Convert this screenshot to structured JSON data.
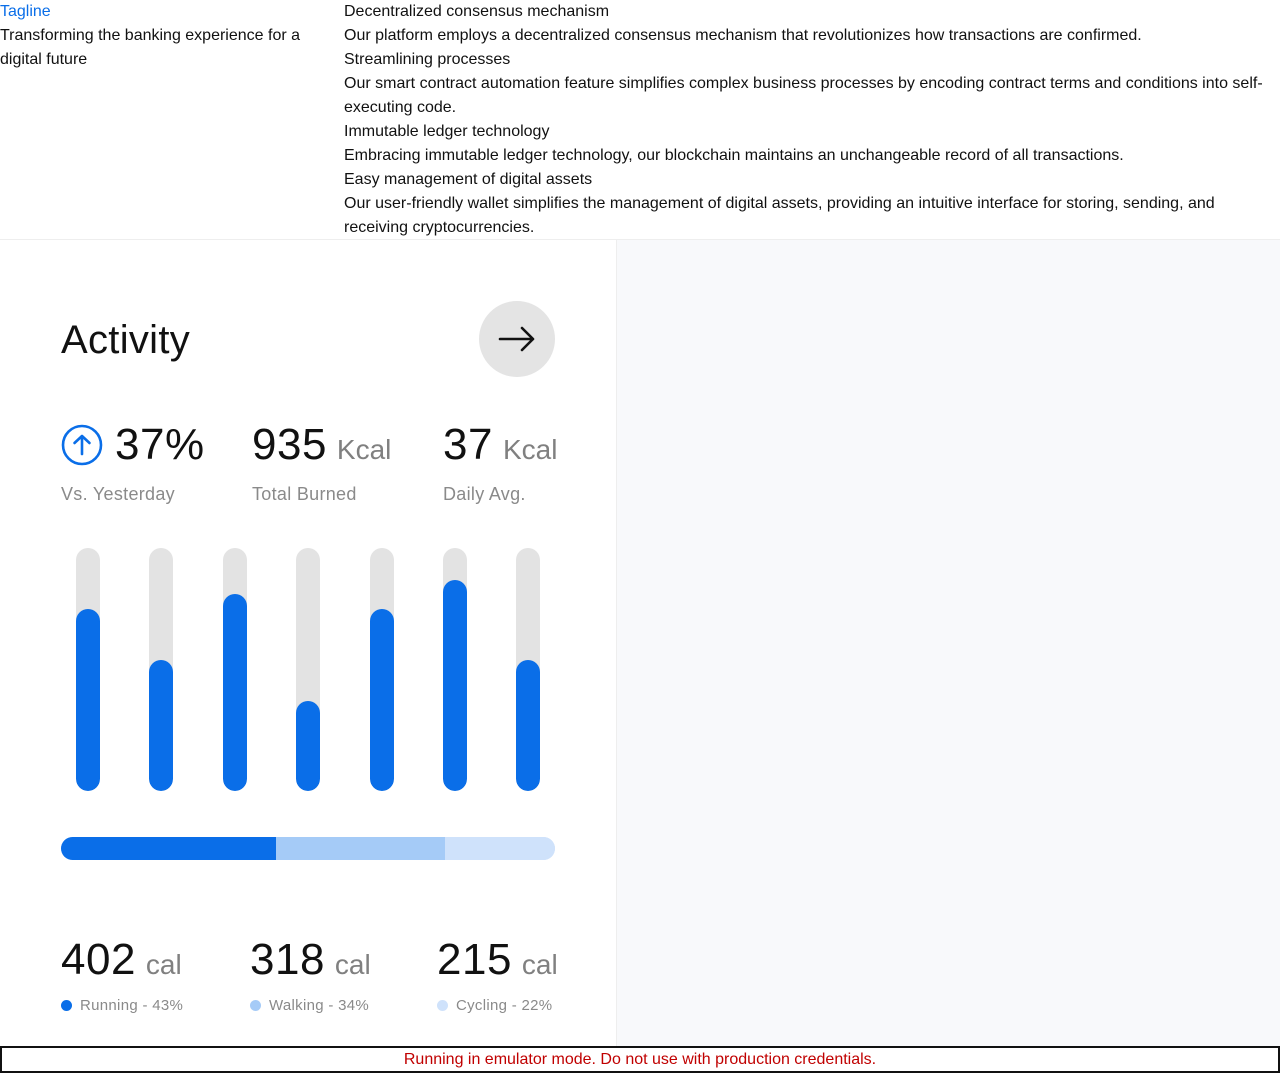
{
  "top": {
    "tagline_label": "Tagline",
    "tagline_text": "Transforming the banking experience for a digital future",
    "features": [
      {
        "title": "Decentralized consensus mechanism",
        "desc": "Our platform employs a decentralized consensus mechanism that revolutionizes how transactions are confirmed."
      },
      {
        "title": "Streamlining processes",
        "desc": "Our smart contract automation feature simplifies complex business processes by encoding contract terms and conditions into self-executing code."
      },
      {
        "title": "Immutable ledger technology",
        "desc": "Embracing immutable ledger technology, our blockchain maintains an unchangeable record of all transactions."
      },
      {
        "title": "Easy management of digital assets",
        "desc": "Our user-friendly wallet simplifies the management of digital assets, providing an intuitive interface for storing, sending, and receiving cryptocurrencies."
      }
    ]
  },
  "card": {
    "title": "Activity",
    "arrow_icon": "arrow-right-icon",
    "stats": [
      {
        "value": "37%",
        "unit": "",
        "label": "Vs. Yesterday",
        "icon": "arrow-up-circle-icon"
      },
      {
        "value": "935",
        "unit": "Kcal",
        "label": "Total Burned"
      },
      {
        "value": "37",
        "unit": "Kcal",
        "label": "Daily Avg."
      }
    ],
    "chart_data": {
      "type": "bar",
      "values": [
        0.75,
        0.54,
        0.81,
        0.37,
        0.75,
        0.87,
        0.54
      ]
    },
    "breakdown": [
      {
        "value": "402",
        "unit": "cal",
        "label": "Running - 43%",
        "fraction": 0.43,
        "color": "#0a6ee8"
      },
      {
        "value": "318",
        "unit": "cal",
        "label": "Walking - 34%",
        "fraction": 0.34,
        "color": "#a5cbf7"
      },
      {
        "value": "215",
        "unit": "cal",
        "label": "Cycling - 22%",
        "fraction": 0.22,
        "color": "#cfe2fb"
      }
    ]
  },
  "colors": {
    "accent": "#0a6ee8",
    "track": "#e3e3e3",
    "panel": "#f8f9fb",
    "banner_text": "#c00000"
  },
  "banner": {
    "text": "Running in emulator mode. Do not use with production credentials."
  }
}
